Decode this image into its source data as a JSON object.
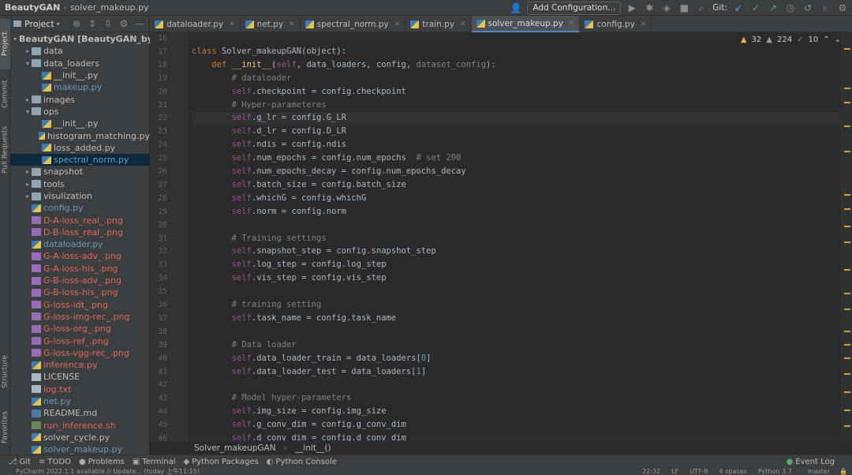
{
  "topbar": {
    "project": "BeautyGAN",
    "file": "solver_makeup.py",
    "add_config": "Add Configuration...",
    "git_label": "Git:"
  },
  "left_strip": {
    "project": "Project",
    "commit": "Commit",
    "pull_requests": "Pull Requests",
    "structure": "Structure",
    "favorites": "Favorites"
  },
  "project_panel": {
    "title": "Project",
    "tree": [
      {
        "depth": 0,
        "kind": "folder",
        "open": true,
        "label": "BeautyGAN [BeautyGAN_by",
        "cls": "plain",
        "bold": true
      },
      {
        "depth": 1,
        "kind": "folder",
        "open": false,
        "label": "data",
        "cls": "plain"
      },
      {
        "depth": 1,
        "kind": "folder",
        "open": true,
        "label": "data_loaders",
        "cls": "plain"
      },
      {
        "depth": 2,
        "kind": "py",
        "label": "__init__.py",
        "cls": "plain"
      },
      {
        "depth": 2,
        "kind": "py",
        "label": "makeup.py",
        "cls": "blue"
      },
      {
        "depth": 1,
        "kind": "folder",
        "open": false,
        "label": "images",
        "cls": "plain"
      },
      {
        "depth": 1,
        "kind": "folder",
        "open": true,
        "label": "ops",
        "cls": "plain"
      },
      {
        "depth": 2,
        "kind": "py",
        "label": "__init__.py",
        "cls": "plain"
      },
      {
        "depth": 2,
        "kind": "py",
        "label": "histogram_matching.py",
        "cls": "plain"
      },
      {
        "depth": 2,
        "kind": "py",
        "label": "loss_added.py",
        "cls": "plain"
      },
      {
        "depth": 2,
        "kind": "py",
        "label": "spectral_norm.py",
        "cls": "blue",
        "selected": true
      },
      {
        "depth": 1,
        "kind": "folder",
        "open": false,
        "label": "snapshot",
        "cls": "plain"
      },
      {
        "depth": 1,
        "kind": "folder",
        "open": false,
        "label": "tools",
        "cls": "plain"
      },
      {
        "depth": 1,
        "kind": "folder",
        "open": false,
        "label": "visulization",
        "cls": "plain"
      },
      {
        "depth": 1,
        "kind": "py",
        "label": "config.py",
        "cls": "blue"
      },
      {
        "depth": 1,
        "kind": "png",
        "label": "D-A-loss_real_.png",
        "cls": "red"
      },
      {
        "depth": 1,
        "kind": "png",
        "label": "D-B-loss_real_.png",
        "cls": "red"
      },
      {
        "depth": 1,
        "kind": "py",
        "label": "dataloader.py",
        "cls": "blue"
      },
      {
        "depth": 1,
        "kind": "png",
        "label": "G-A-loss-adv_.png",
        "cls": "red"
      },
      {
        "depth": 1,
        "kind": "png",
        "label": "G-A-loss-his_.png",
        "cls": "red"
      },
      {
        "depth": 1,
        "kind": "png",
        "label": "G-B-loss-adv_.png",
        "cls": "red"
      },
      {
        "depth": 1,
        "kind": "png",
        "label": "G-B-loss-his_.png",
        "cls": "red"
      },
      {
        "depth": 1,
        "kind": "png",
        "label": "G-loss-idt_.png",
        "cls": "red"
      },
      {
        "depth": 1,
        "kind": "png",
        "label": "G-loss-img-rec_.png",
        "cls": "red"
      },
      {
        "depth": 1,
        "kind": "png",
        "label": "G-loss-org_.png",
        "cls": "red"
      },
      {
        "depth": 1,
        "kind": "png",
        "label": "G-loss-ref_.png",
        "cls": "red"
      },
      {
        "depth": 1,
        "kind": "png",
        "label": "G-loss-vgg-rec_.png",
        "cls": "red"
      },
      {
        "depth": 1,
        "kind": "py",
        "label": "inference.py",
        "cls": "red"
      },
      {
        "depth": 1,
        "kind": "txt",
        "label": "LICENSE",
        "cls": "plain"
      },
      {
        "depth": 1,
        "kind": "txt",
        "label": "log.txt",
        "cls": "red"
      },
      {
        "depth": 1,
        "kind": "py",
        "label": "net.py",
        "cls": "blue"
      },
      {
        "depth": 1,
        "kind": "md",
        "label": "README.md",
        "cls": "plain"
      },
      {
        "depth": 1,
        "kind": "sh",
        "label": "run_inference.sh",
        "cls": "red"
      },
      {
        "depth": 1,
        "kind": "py",
        "label": "solver_cycle.py",
        "cls": "plain"
      },
      {
        "depth": 1,
        "kind": "py",
        "label": "solver_makeup.py",
        "cls": "blue"
      }
    ]
  },
  "tabs": [
    {
      "label": "dataloader.py",
      "active": false
    },
    {
      "label": "net.py",
      "active": false
    },
    {
      "label": "spectral_norm.py",
      "active": false
    },
    {
      "label": "train.py",
      "active": false
    },
    {
      "label": "solver_makeup.py",
      "active": true
    },
    {
      "label": "config.py",
      "active": false
    }
  ],
  "inspections": {
    "warnings": "32",
    "weak": "224",
    "ok": "10"
  },
  "editor": {
    "current_line": "22",
    "lines": [
      {
        "n": "16",
        "t": []
      },
      {
        "n": "17",
        "t": [
          [
            "kw",
            "class "
          ],
          [
            "",
            "Solver_makeupGAN("
          ],
          [
            "",
            "object"
          ],
          [
            "",
            "):"
          ]
        ]
      },
      {
        "n": "18",
        "t": [
          [
            "",
            "    "
          ],
          [
            "kw",
            "def "
          ],
          [
            "fn",
            "__init__"
          ],
          [
            "",
            "("
          ],
          [
            "sf",
            "self"
          ],
          [
            "",
            ", data_loaders, config, "
          ],
          [
            "cm",
            "dataset_config"
          ],
          [
            "",
            "):"
          ]
        ]
      },
      {
        "n": "19",
        "t": [
          [
            "",
            "        "
          ],
          [
            "cm",
            "# dataloader"
          ]
        ]
      },
      {
        "n": "20",
        "t": [
          [
            "",
            "        "
          ],
          [
            "sf",
            "self"
          ],
          [
            "",
            ".checkpoint = config.checkpoint"
          ]
        ]
      },
      {
        "n": "21",
        "t": [
          [
            "",
            "        "
          ],
          [
            "cm",
            "# Hyper-parameteres"
          ]
        ]
      },
      {
        "n": "22",
        "t": [
          [
            "",
            "        "
          ],
          [
            "sf",
            "self"
          ],
          [
            "",
            ".g_lr = config.G_LR"
          ]
        ]
      },
      {
        "n": "23",
        "t": [
          [
            "",
            "        "
          ],
          [
            "sf",
            "self"
          ],
          [
            "",
            ".d_lr = config.D_LR"
          ]
        ]
      },
      {
        "n": "24",
        "t": [
          [
            "",
            "        "
          ],
          [
            "sf",
            "self"
          ],
          [
            "",
            ".ndis = config.ndis"
          ]
        ]
      },
      {
        "n": "25",
        "t": [
          [
            "",
            "        "
          ],
          [
            "sf",
            "self"
          ],
          [
            "",
            ".num_epochs = config.num_epochs  "
          ],
          [
            "cm",
            "# set 200"
          ]
        ]
      },
      {
        "n": "26",
        "t": [
          [
            "",
            "        "
          ],
          [
            "sf",
            "self"
          ],
          [
            "",
            ".num_epochs_decay = config.num_epochs_decay"
          ]
        ]
      },
      {
        "n": "27",
        "t": [
          [
            "",
            "        "
          ],
          [
            "sf",
            "self"
          ],
          [
            "",
            ".batch_size = config.batch_size"
          ]
        ]
      },
      {
        "n": "28",
        "t": [
          [
            "",
            "        "
          ],
          [
            "sf",
            "self"
          ],
          [
            "",
            ".whichG = config.whichG"
          ]
        ]
      },
      {
        "n": "29",
        "t": [
          [
            "",
            "        "
          ],
          [
            "sf",
            "self"
          ],
          [
            "",
            ".norm = config.norm"
          ]
        ]
      },
      {
        "n": "30",
        "t": []
      },
      {
        "n": "31",
        "t": [
          [
            "",
            "        "
          ],
          [
            "cm",
            "# Training settings"
          ]
        ]
      },
      {
        "n": "32",
        "t": [
          [
            "",
            "        "
          ],
          [
            "sf",
            "self"
          ],
          [
            "",
            ".snapshot_step = config.snapshot_step"
          ]
        ]
      },
      {
        "n": "33",
        "t": [
          [
            "",
            "        "
          ],
          [
            "sf",
            "self"
          ],
          [
            "",
            ".log_step = config.log_step"
          ]
        ]
      },
      {
        "n": "34",
        "t": [
          [
            "",
            "        "
          ],
          [
            "sf",
            "self"
          ],
          [
            "",
            ".vis_step = config.vis_step"
          ]
        ]
      },
      {
        "n": "35",
        "t": []
      },
      {
        "n": "36",
        "t": [
          [
            "",
            "        "
          ],
          [
            "cm",
            "# training setting"
          ]
        ]
      },
      {
        "n": "37",
        "t": [
          [
            "",
            "        "
          ],
          [
            "sf",
            "self"
          ],
          [
            "",
            ".task_name = config.task_name"
          ]
        ]
      },
      {
        "n": "38",
        "t": []
      },
      {
        "n": "39",
        "t": [
          [
            "",
            "        "
          ],
          [
            "cm",
            "# Data loader"
          ]
        ]
      },
      {
        "n": "40",
        "t": [
          [
            "",
            "        "
          ],
          [
            "sf",
            "self"
          ],
          [
            "",
            ".data_loader_train = data_loaders["
          ],
          [
            "num",
            "0"
          ],
          [
            "",
            "]"
          ]
        ]
      },
      {
        "n": "41",
        "t": [
          [
            "",
            "        "
          ],
          [
            "sf",
            "self"
          ],
          [
            "",
            ".data_loader_test = data_loaders["
          ],
          [
            "num",
            "1"
          ],
          [
            "",
            "]"
          ]
        ]
      },
      {
        "n": "42",
        "t": []
      },
      {
        "n": "43",
        "t": [
          [
            "",
            "        "
          ],
          [
            "cm",
            "# Model hyper-parameters"
          ]
        ]
      },
      {
        "n": "44",
        "t": [
          [
            "",
            "        "
          ],
          [
            "sf",
            "self"
          ],
          [
            "",
            ".img_size = config.img_size"
          ]
        ]
      },
      {
        "n": "45",
        "t": [
          [
            "",
            "        "
          ],
          [
            "sf",
            "self"
          ],
          [
            "",
            ".g_conv_dim = config.g_conv_dim"
          ]
        ]
      },
      {
        "n": "46",
        "t": [
          [
            "",
            "        "
          ],
          [
            "sf",
            "self"
          ],
          [
            "",
            ".d_conv_dim = config.d_conv_dim"
          ]
        ]
      }
    ]
  },
  "breadcrumb": {
    "cls": "Solver_makeupGAN",
    "method": "__init__()"
  },
  "bottom_tools": [
    {
      "label": "Git",
      "icon": "git-icon"
    },
    {
      "label": "TODO",
      "icon": "todo-icon"
    },
    {
      "label": "Problems",
      "icon": "problems-icon"
    },
    {
      "label": "Terminal",
      "icon": "terminal-icon"
    },
    {
      "label": "Python Packages",
      "icon": "packages-icon"
    },
    {
      "label": "Python Console",
      "icon": "console-icon"
    }
  ],
  "event_log": "Event Log",
  "status": {
    "message": "PyCharm 2022.1.1 available // Update... (today 上午11:15)",
    "position": "22:32",
    "line_sep": "LF",
    "encoding": "UTF-8",
    "indent": "4 spaces",
    "interpreter": "Python 3.7",
    "branch": "master"
  },
  "colors": {
    "accent": "#4a88c7",
    "selected_row": "#0d293e",
    "keyword": "#cc7832",
    "self": "#94558d",
    "comment": "#808080"
  }
}
